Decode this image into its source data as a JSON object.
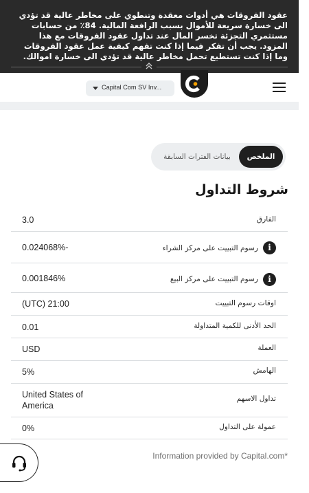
{
  "risk_banner": {
    "text": "عقود الفروقات هي أدوات معقدة وتنطوي على مخاطر عالية قد تؤدي الى خسارة سريعة للأموال بسبب الرافعة المالية. 84٪ من حسابات مستثمري التجزئة تخسر المال عند تداول عقود الفروقات مع هذا المزود. يجب أن تفكر فيما إذا كنت تفهم كيفية عمل عقود الفروقات وما إذا كنت تستطيع تحمل مخاطر عالية قد تؤدي الى خسارة اموالك.",
    "collapse_icon": "double-chevron-up"
  },
  "header": {
    "entity_select": "Capital Com SV Inv...",
    "logo_icon": "capital-logo",
    "menu_icon": "hamburger"
  },
  "tabs": {
    "summary": "الملخص",
    "history": "بيانات الفترات السابقة"
  },
  "section_title": "شروط التداول",
  "table": [
    {
      "label": "الفارق",
      "value": "3.0"
    },
    {
      "label": "رسوم التبييت على مركز الشراء",
      "value": "0.024068%-",
      "info": true
    },
    {
      "label": "رسوم التبييت على مركز البيع",
      "value": "0.001846%",
      "info": true
    },
    {
      "label": "اوقات رسوم التبييت",
      "value": "(UTC) 21:00"
    },
    {
      "label": "الحد الأدنى للكمية المتداولة",
      "value": "0.01"
    },
    {
      "label": "العملة",
      "value": "USD"
    },
    {
      "label": "الهامش",
      "value": "5%"
    },
    {
      "label": "تداول الاسهم",
      "value": "United States of America"
    },
    {
      "label": "عمولة على التداول",
      "value": "0%"
    }
  ],
  "info_glyph": "i",
  "source": "Information provided by Capital.com*",
  "support_icon": "headset",
  "colors": {
    "dark": "#1f1f1f",
    "banner": "#2a2a2a",
    "divider": "#d9dcdf",
    "tab_bg": "#eceef0"
  }
}
